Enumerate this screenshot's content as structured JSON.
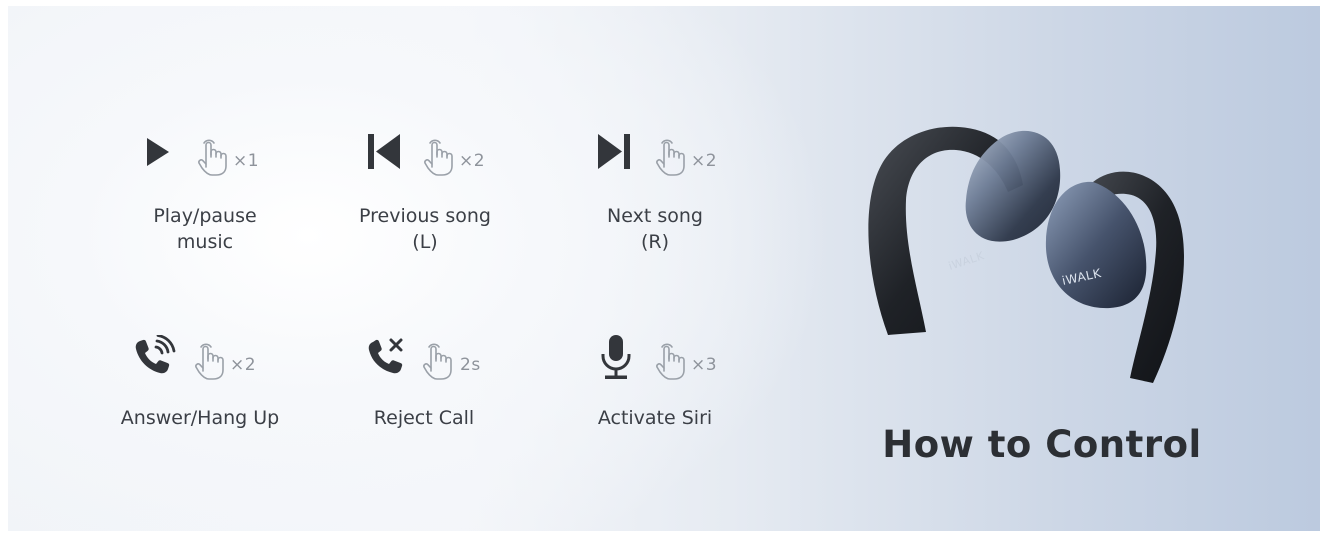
{
  "title": "How to Control",
  "brand": "iWALK",
  "colors": {
    "icon_dark": "#33363b",
    "tap_gray": "#9aa0a8",
    "text": "#3b3f46",
    "title": "#2c2f34"
  },
  "controls": [
    {
      "icon": "play-icon",
      "tap": "×1",
      "line1": "Play/pause",
      "line2": "music"
    },
    {
      "icon": "previous-track-icon",
      "tap": "×2",
      "line1": "Previous song",
      "line2": "(L)"
    },
    {
      "icon": "next-track-icon",
      "tap": "×2",
      "line1": "Next song",
      "line2": "(R)"
    },
    {
      "icon": "phone-ringing-icon",
      "tap": "×2",
      "line1": "Answer/Hang Up",
      "line2": ""
    },
    {
      "icon": "phone-reject-icon",
      "tap": "2s",
      "line1": "Reject Call",
      "line2": ""
    },
    {
      "icon": "microphone-icon",
      "tap": "×3",
      "line1": "Activate Siri",
      "line2": ""
    }
  ]
}
